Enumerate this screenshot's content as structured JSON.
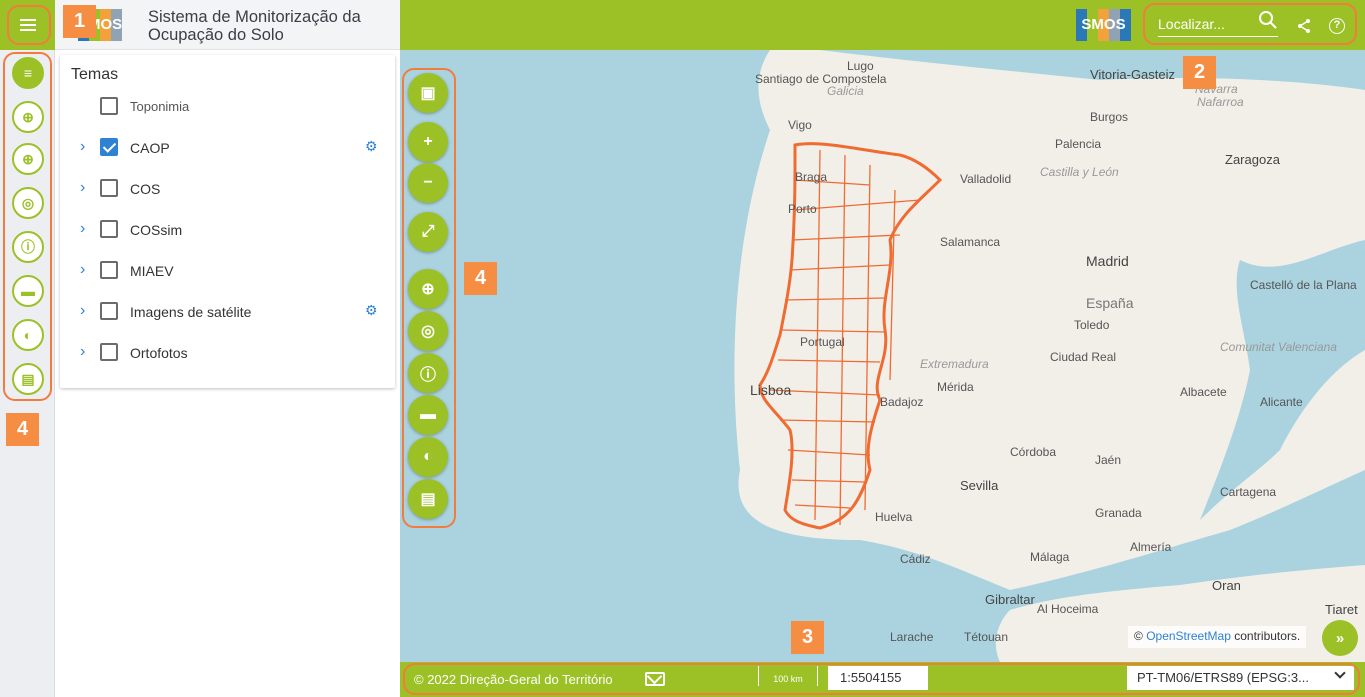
{
  "header": {
    "logo_text": "SMOS",
    "title": "Sistema de Monitorização da Ocupação do Solo",
    "search_placeholder": "Localizar..."
  },
  "panel": {
    "title": "Temas",
    "layers": [
      {
        "label": "Toponimia",
        "checked": false,
        "expandable": false,
        "settings": false
      },
      {
        "label": "CAOP",
        "checked": true,
        "expandable": true,
        "settings": true
      },
      {
        "label": "COS",
        "checked": false,
        "expandable": true,
        "settings": false
      },
      {
        "label": "COSsim",
        "checked": false,
        "expandable": true,
        "settings": false
      },
      {
        "label": "MIAEV",
        "checked": false,
        "expandable": true,
        "settings": false
      },
      {
        "label": "Imagens de satélite",
        "checked": false,
        "expandable": true,
        "settings": true
      },
      {
        "label": "Ortofotos",
        "checked": false,
        "expandable": true,
        "settings": false
      }
    ]
  },
  "map": {
    "labels": [
      "Santiago de Compostela",
      "Lugo",
      "Vitoria-Gasteiz",
      "Navarra",
      "Vigo",
      "Galicia",
      "Burgos",
      "Nafarroa",
      "Braga",
      "Porto",
      "Palencia",
      "Zaragoza",
      "Valladolid",
      "Castilla y León",
      "Salamanca",
      "Madrid",
      "Portugal",
      "Toledo",
      "España",
      "Castelló de la Plana",
      "Comunitat Valenciana",
      "Lisboa",
      "Ciudad Real",
      "Extremadura",
      "Mérida",
      "Badajoz",
      "Albacete",
      "Alicante",
      "Córdoba",
      "Jaén",
      "Sevilla",
      "Cartagena",
      "Huelva",
      "Granada",
      "Cádiz",
      "Málaga",
      "Almería",
      "Gibraltar",
      "Al Hoceima",
      "Oran",
      "Tiaret",
      "Larache",
      "Tétouan"
    ],
    "attribution_link": "OpenStreetMap",
    "attribution_suffix": " contributors.",
    "attribution_prefix": "© "
  },
  "footer": {
    "copyright": "© 2022 Direção-Geral do Território",
    "scale_bar": "100 km",
    "scale_value": "1:5504155",
    "projection": "PT-TM06/ETRS89 (EPSG:3..."
  },
  "callouts": [
    "1",
    "2",
    "3",
    "4",
    "4"
  ],
  "colors": {
    "accent": "#9cc126",
    "callout": "#f58d42",
    "boundary": "#f06b32",
    "link": "#2d82d4"
  }
}
